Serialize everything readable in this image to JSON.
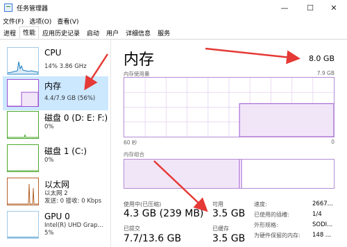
{
  "window": {
    "title": "任务管理器",
    "min_icon": "—",
    "max_icon": "☐",
    "close_icon": "✕"
  },
  "menu": [
    "文件(F)",
    "选项(O)",
    "查看(V)"
  ],
  "tabs": [
    {
      "label": "进程",
      "active": false
    },
    {
      "label": "性能",
      "active": true
    },
    {
      "label": "应用历史记录",
      "active": false
    },
    {
      "label": "启动",
      "active": false
    },
    {
      "label": "用户",
      "active": false
    },
    {
      "label": "详细信息",
      "active": false
    },
    {
      "label": "服务",
      "active": false
    }
  ],
  "sidebar": [
    {
      "title": "CPU",
      "sub1": "14%  3.86 GHz",
      "sub2": "",
      "color": "#1a7fc1"
    },
    {
      "title": "内存",
      "sub1": "4.4/7.9 GB (56%)",
      "sub2": "",
      "color": "#9b4fd0"
    },
    {
      "title": "磁盘 0 (D: E: F:)",
      "sub1": "0%",
      "sub2": "",
      "color": "#4da82d"
    },
    {
      "title": "磁盘 1 (C:)",
      "sub1": "0%",
      "sub2": "",
      "color": "#4da82d"
    },
    {
      "title": "以太网",
      "sub1": "以太网 2",
      "sub2": "发送: 0 接收: 0 Kbps",
      "color": "#b3622a"
    },
    {
      "title": "GPU 0",
      "sub1": "Intel(R) UHD Grap...",
      "sub2": "5%",
      "color": "#1a7fc1"
    }
  ],
  "main": {
    "title": "内存",
    "total": "8.0 GB",
    "usage_label": "内存使用量",
    "usage_max": "7.9 GB",
    "time_left": "60 秒",
    "time_right": "0",
    "composition_label": "内存组合",
    "usage_fraction_recent": 0.56
  },
  "stats": {
    "in_use_label": "使用中(已压缩)",
    "in_use_value": "4.3 GB (239 MB)",
    "available_label": "可用",
    "available_value": "3.5 GB",
    "committed_label": "已提交",
    "committed_value": "7.7/13.6 GB",
    "cached_label": "已缓存",
    "cached_value": "3.5 GB",
    "speed_label": "速度:",
    "speed_value": "2667...",
    "slots_label": "已使用的插槽:",
    "slots_value": "1/4",
    "form_label": "外形规格:",
    "form_value": "SODI...",
    "reserved_label": "为硬件保留的内存:",
    "reserved_value": "148 ..."
  },
  "colors": {
    "accent": "#9b4fd0",
    "selected": "#cce8ff",
    "arrow": "#e53935"
  }
}
